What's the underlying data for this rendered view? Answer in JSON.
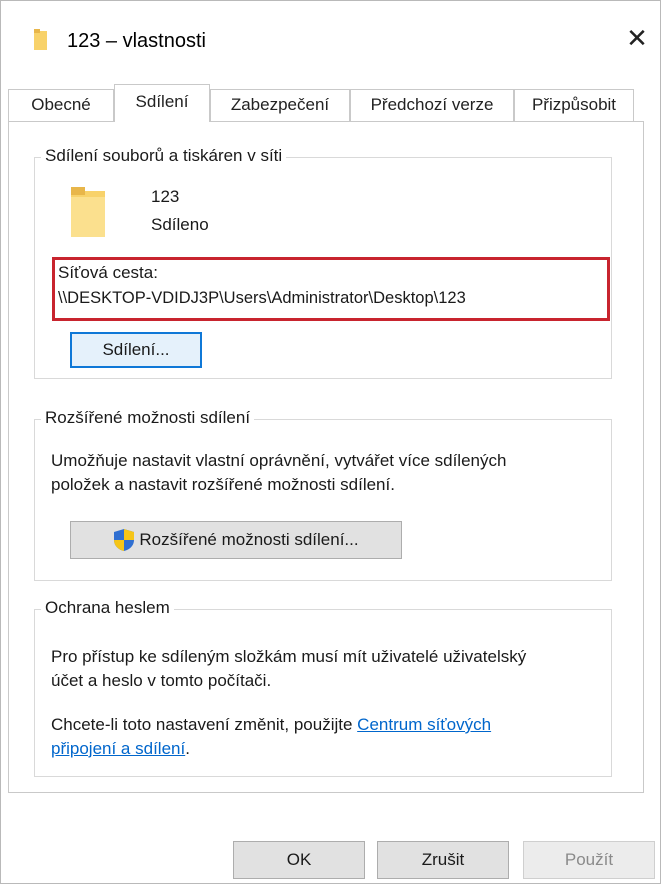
{
  "window": {
    "title": "123 – vlastnosti",
    "close_glyph": "✕",
    "accent_color": "#0f78d7",
    "highlight_color": "#c8242e"
  },
  "tabs": [
    {
      "label": "Obecné",
      "active": false
    },
    {
      "label": "Sdílení",
      "active": true
    },
    {
      "label": "Zabezpečení",
      "active": false
    },
    {
      "label": "Předchozí verze",
      "active": false
    },
    {
      "label": "Přizpůsobit",
      "active": false
    }
  ],
  "sharing": {
    "legend": "Sdílení souborů a tiskáren v síti",
    "folder_name": "123",
    "folder_status": "Sdíleno",
    "network_path_label": "Síťová cesta:",
    "network_path": "\\\\DESKTOP-VDIDJ3P\\Users\\Administrator\\Desktop\\123",
    "share_button": "Sdílení..."
  },
  "advanced": {
    "legend": "Rozšířené možnosti sdílení",
    "description_line1": "Umožňuje nastavit vlastní oprávnění, vytvářet více sdílených",
    "description_line2": "položek a nastavit rozšířené možnosti sdílení.",
    "button": "Rozšířené možnosti sdílení...",
    "button_icon": "uac-shield-icon"
  },
  "password": {
    "legend": "Ochrana heslem",
    "description_line1": "Pro přístup ke sdíleným složkám musí mít uživatelé uživatelský",
    "description_line2": "účet a heslo v tomto počítači.",
    "change_text": "Chcete-li toto nastavení změnit, použijte ",
    "link_line1": "Centrum síťových",
    "link_line2": "připojení a sdílení",
    "link_suffix": "."
  },
  "footer": {
    "ok": "OK",
    "cancel": "Zrušit",
    "apply": "Použít"
  }
}
